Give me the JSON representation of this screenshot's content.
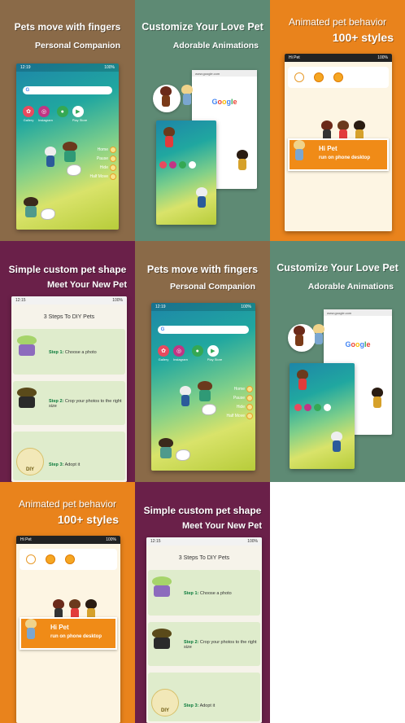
{
  "tiles": [
    {
      "head1": "Pets move with fingers",
      "head2": "Personal Companion"
    },
    {
      "head1": "Customize Your Love Pet",
      "head2": "Adorable Animations"
    },
    {
      "head1": "Animated pet behavior",
      "head2": "100+ styles"
    },
    {
      "head1": "Simple custom pet shape",
      "head2": "Meet Your New Pet"
    },
    {
      "head1": "Pets move with fingers",
      "head2": "Personal Companion"
    },
    {
      "head1": "Customize Your Love Pet",
      "head2": "Adorable Animations"
    },
    {
      "head1": "Animated pet behavior",
      "head2": "100+ styles"
    },
    {
      "head1": "Simple custom pet shape",
      "head2": "Meet Your New Pet"
    }
  ],
  "status": {
    "time": "12:19",
    "time2": "12:15",
    "battery": "100%"
  },
  "home": {
    "apps": [
      "Gallery",
      "Instagram",
      "",
      "Play Store"
    ],
    "menu": [
      "Home",
      "Pause",
      "Hide",
      "Half Move"
    ]
  },
  "browser": {
    "url": "www.google.com",
    "logo": [
      "G",
      "o",
      "o",
      "g",
      "l",
      "e"
    ]
  },
  "hipet": {
    "title": "Hi Pet",
    "banner_title": "Hi Pet",
    "banner_sub": "run on phone desktop"
  },
  "diy": {
    "title": "3 Steps To DIY Pets",
    "steps": [
      {
        "num": "Step 1:",
        "text": "Choose a photo"
      },
      {
        "num": "Step 2:",
        "text": "Crop your photos to the right size"
      },
      {
        "num": "Step 3:",
        "text": "Adopt it"
      }
    ],
    "badge": "DIY"
  },
  "colors": {
    "brown": "#8a6a48",
    "green": "#5e8a74",
    "orange": "#e9831c",
    "purple": "#6a2049"
  }
}
